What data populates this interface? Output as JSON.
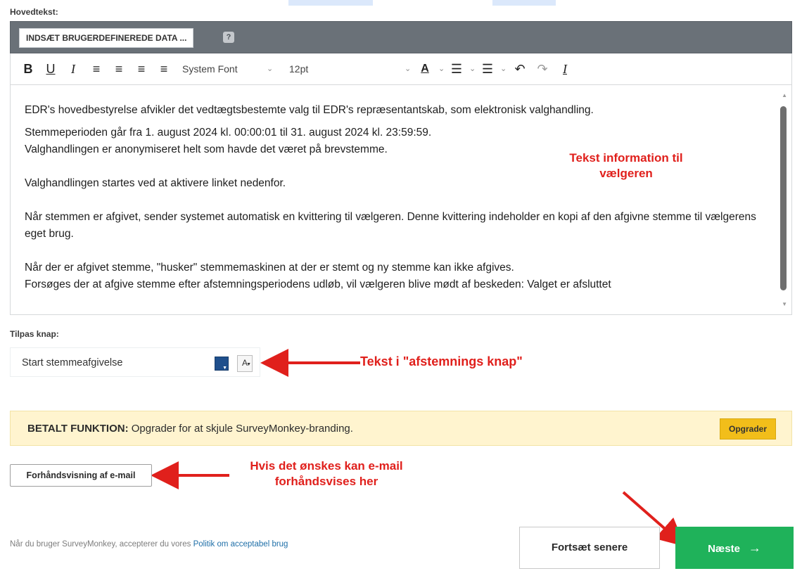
{
  "main_text": {
    "label": "Hovedtekst:",
    "insert_button": "INDSÆT BRUGERDEFINEREDE DATA ...",
    "help_icon": "?"
  },
  "toolbar": {
    "bold": "B",
    "underline": "U",
    "italic": "I",
    "align_left": "≡",
    "align_center": "≡",
    "align_right": "≡",
    "justify": "≡",
    "font_family": "System Font",
    "font_size": "12pt",
    "text_color": "A",
    "bullet_list": "☰",
    "numbered_list": "☰",
    "undo": "↶",
    "redo": "↷",
    "clear_format": "I"
  },
  "editor": {
    "paragraphs": [
      "EDR's hovedbestyrelse afvikler det vedtægtsbestemte valg til EDR's repræsentantskab, som elektronisk valghandling.",
      "Stemmeperioden går fra 1. august 2024 kl. 00:00:01 til 31. august 2024 kl. 23:59:59.",
      "Valghandlingen er anonymiseret helt som havde det været på brevstemme.",
      "Valghandlingen startes ved at aktivere linket nedenfor.",
      "Når stemmen er afgivet, sender systemet automatisk en kvittering til vælgeren. Denne kvittering indeholder en kopi af den afgivne stemme til vælgerens eget brug.",
      "Når der er afgivet stemme, \"husker\" stemmemaskinen at der er stemt og ny stemme kan ikke afgives.",
      "Forsøges der at afgive stemme efter afstemningsperiodens udløb, vil vælgeren blive mødt af beskeden: Valget er afsluttet"
    ]
  },
  "annotations": {
    "text_info_line1": "Tekst information til",
    "text_info_line2": "vælgeren",
    "button_text": "Tekst i \"afstemnings knap\"",
    "preview_line1": "Hvis det ønskes kan e-mail",
    "preview_line2": "forhåndsvises her"
  },
  "custom_button": {
    "label": "Tilpas knap:",
    "text": "Start stemmeafgivelse",
    "font_swatch": "A"
  },
  "paid_banner": {
    "strong": "BETALT FUNKTION:",
    "text": " Opgrader for at skjule SurveyMonkey-branding.",
    "upgrade_button": "Opgrader"
  },
  "preview_button": "Forhåndsvisning af e-mail",
  "footer": {
    "note": "Når du bruger SurveyMonkey, accepterer du vores ",
    "link": "Politik om acceptabel brug"
  },
  "actions": {
    "later": "Fortsæt senere",
    "next": "Næste",
    "next_arrow": "→"
  },
  "colors": {
    "annotation_red": "#e0201c",
    "next_green": "#1fb25a",
    "upgrade_yellow": "#f2be1a",
    "banner_bg": "#fff4cf",
    "swatch_blue": "#1f4f8c"
  }
}
